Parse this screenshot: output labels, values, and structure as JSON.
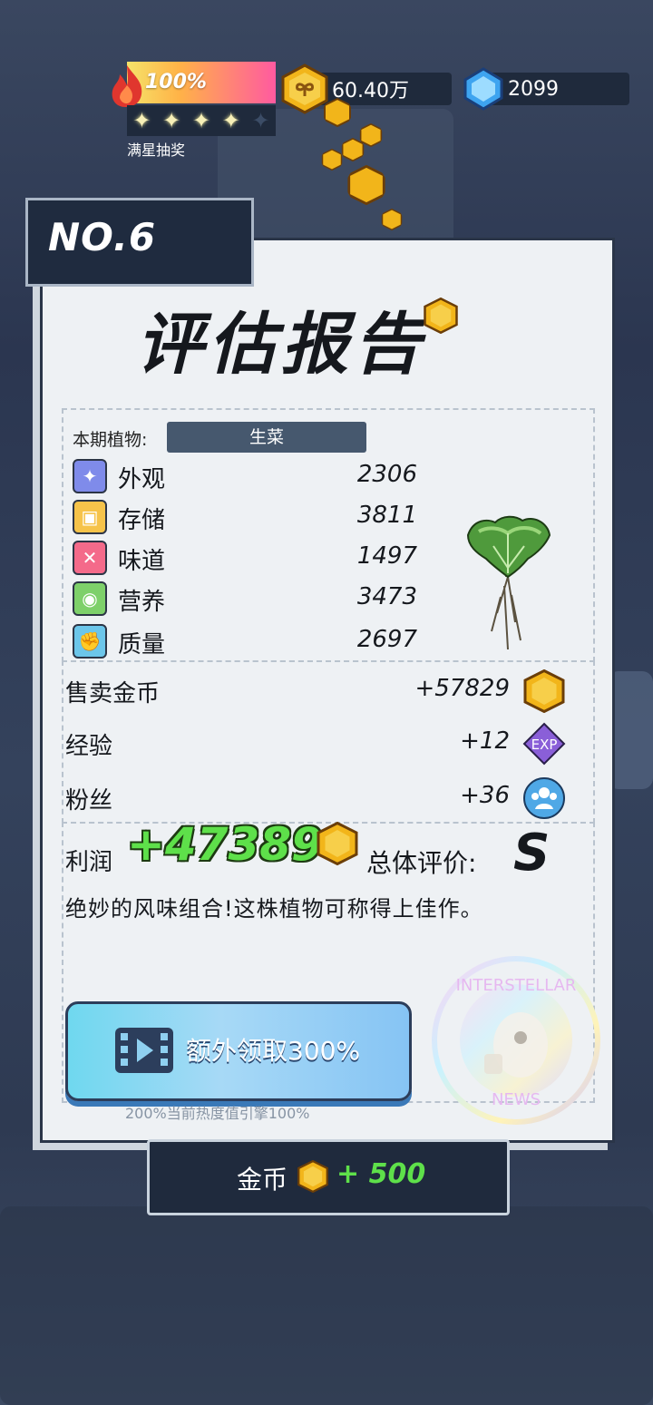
{
  "hud": {
    "progress_percent": "100%",
    "stars_filled": 4,
    "stars_total": 5,
    "star_label": "满星抽奖",
    "gold": "60.40万",
    "gems": "2099"
  },
  "report": {
    "number": "NO.6",
    "title": "评估报告",
    "plant_label": "本期植物:",
    "plant_name": "生菜",
    "stats": [
      {
        "label": "外观",
        "value": "2306",
        "icon": "sparkle-icon",
        "color": "#7f8bea"
      },
      {
        "label": "存储",
        "value": "3811",
        "icon": "box-icon",
        "color": "#f6c34a"
      },
      {
        "label": "味道",
        "value": "1497",
        "icon": "utensils-icon",
        "color": "#f46a8a"
      },
      {
        "label": "营养",
        "value": "3473",
        "icon": "lime-icon",
        "color": "#7ed06a"
      },
      {
        "label": "质量",
        "value": "2697",
        "icon": "muscle-icon",
        "color": "#6cc6ea"
      }
    ],
    "rewards": [
      {
        "label": "售卖金币",
        "value": "+57829",
        "icon": "coin-icon"
      },
      {
        "label": "经验",
        "value": "+12",
        "icon": "exp-icon"
      },
      {
        "label": "粉丝",
        "value": "+36",
        "icon": "fans-icon"
      }
    ],
    "profit_label": "利润",
    "profit_value": "+47389",
    "grade_label": "总体评价:",
    "grade": "S",
    "comment": "绝妙的风味组合!这株植物可称得上佳作。",
    "video_button": "额外领取300%",
    "video_note": "200%当前热度值引擎100%",
    "stamp_text_top": "INTERSTELLAR",
    "stamp_text_bottom": "NEWS"
  },
  "bottom": {
    "label": "金币",
    "value": "+ 500"
  },
  "colors": {
    "coin": "#f2b51a",
    "profit": "#5ee04a",
    "panel_dark": "#1f2a3c"
  }
}
